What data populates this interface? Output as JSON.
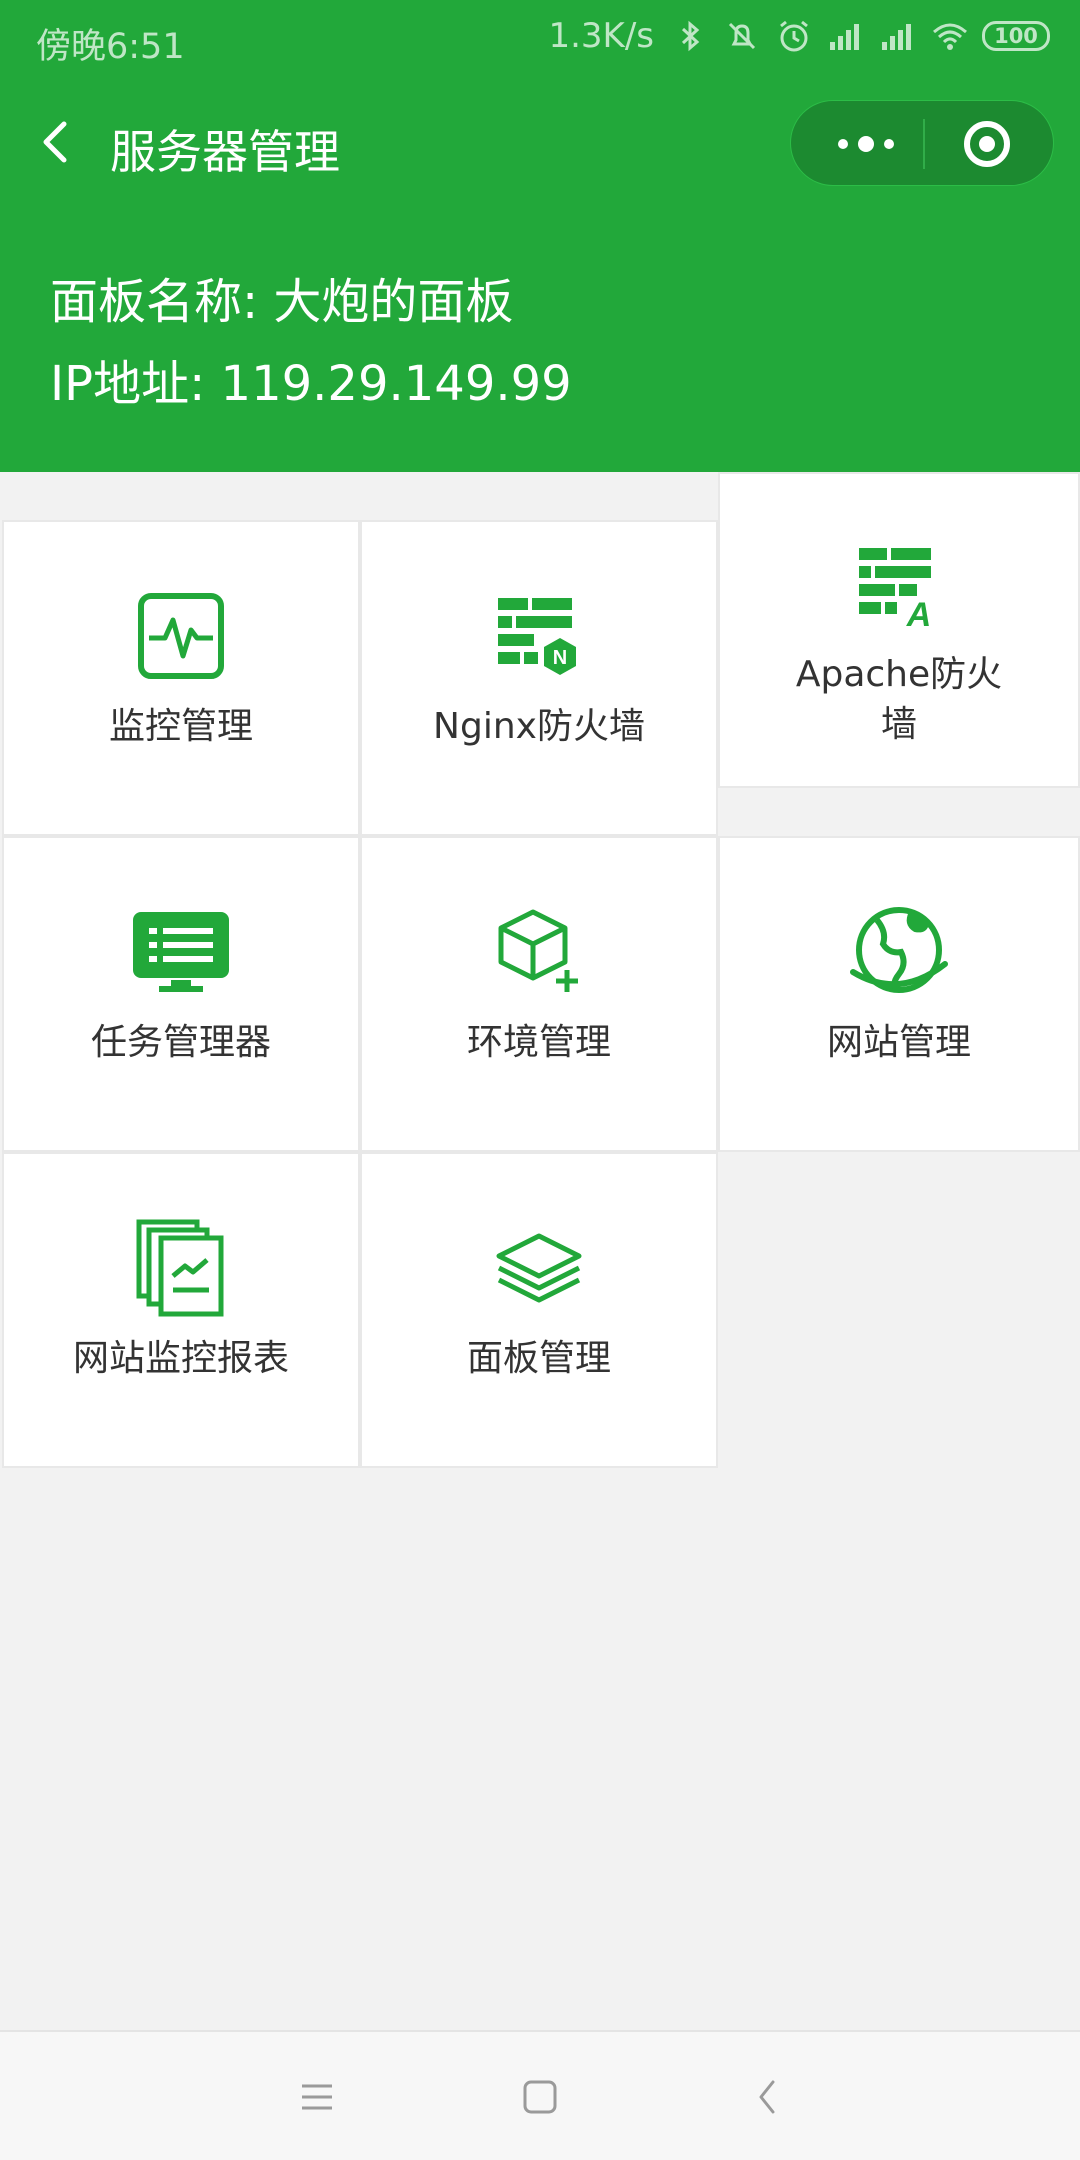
{
  "status_bar": {
    "time": "傍晚6:51",
    "speed": "1.3K/s",
    "battery": "100",
    "icons": [
      "bluetooth-icon",
      "mute-icon",
      "alarm-icon",
      "signal-icon",
      "signal-icon",
      "wifi-icon",
      "battery-icon"
    ]
  },
  "title_bar": {
    "title": "服务器管理",
    "back_icon": "back-arrow-icon",
    "more_icon": "more-dots-icon",
    "close_icon": "target-close-icon"
  },
  "panel_info": {
    "name_line": "面板名称: 大炮的面板",
    "ip_line": "IP地址: 119.29.149.99"
  },
  "tiles": [
    {
      "label": "监控管理",
      "icon": "monitor-pulse-icon"
    },
    {
      "label": "Nginx防火墙",
      "icon": "nginx-firewall-icon"
    },
    {
      "label": "Apache防火墙",
      "icon": "apache-firewall-icon"
    },
    {
      "label": "任务管理器",
      "icon": "task-list-monitor-icon"
    },
    {
      "label": "环境管理",
      "icon": "package-box-add-icon"
    },
    {
      "label": "网站管理",
      "icon": "globe-icon"
    },
    {
      "label": "网站监控报表",
      "icon": "report-documents-icon"
    },
    {
      "label": "面板管理",
      "icon": "layers-stack-icon"
    }
  ],
  "colors": {
    "brand_green": "#22a83a",
    "icon_green": "#22a83a",
    "text_dark": "#333333",
    "background": "#f2f2f2"
  },
  "nav_bar": {
    "buttons": [
      "menu-icon",
      "home-square-icon",
      "back-chevron-icon"
    ]
  }
}
